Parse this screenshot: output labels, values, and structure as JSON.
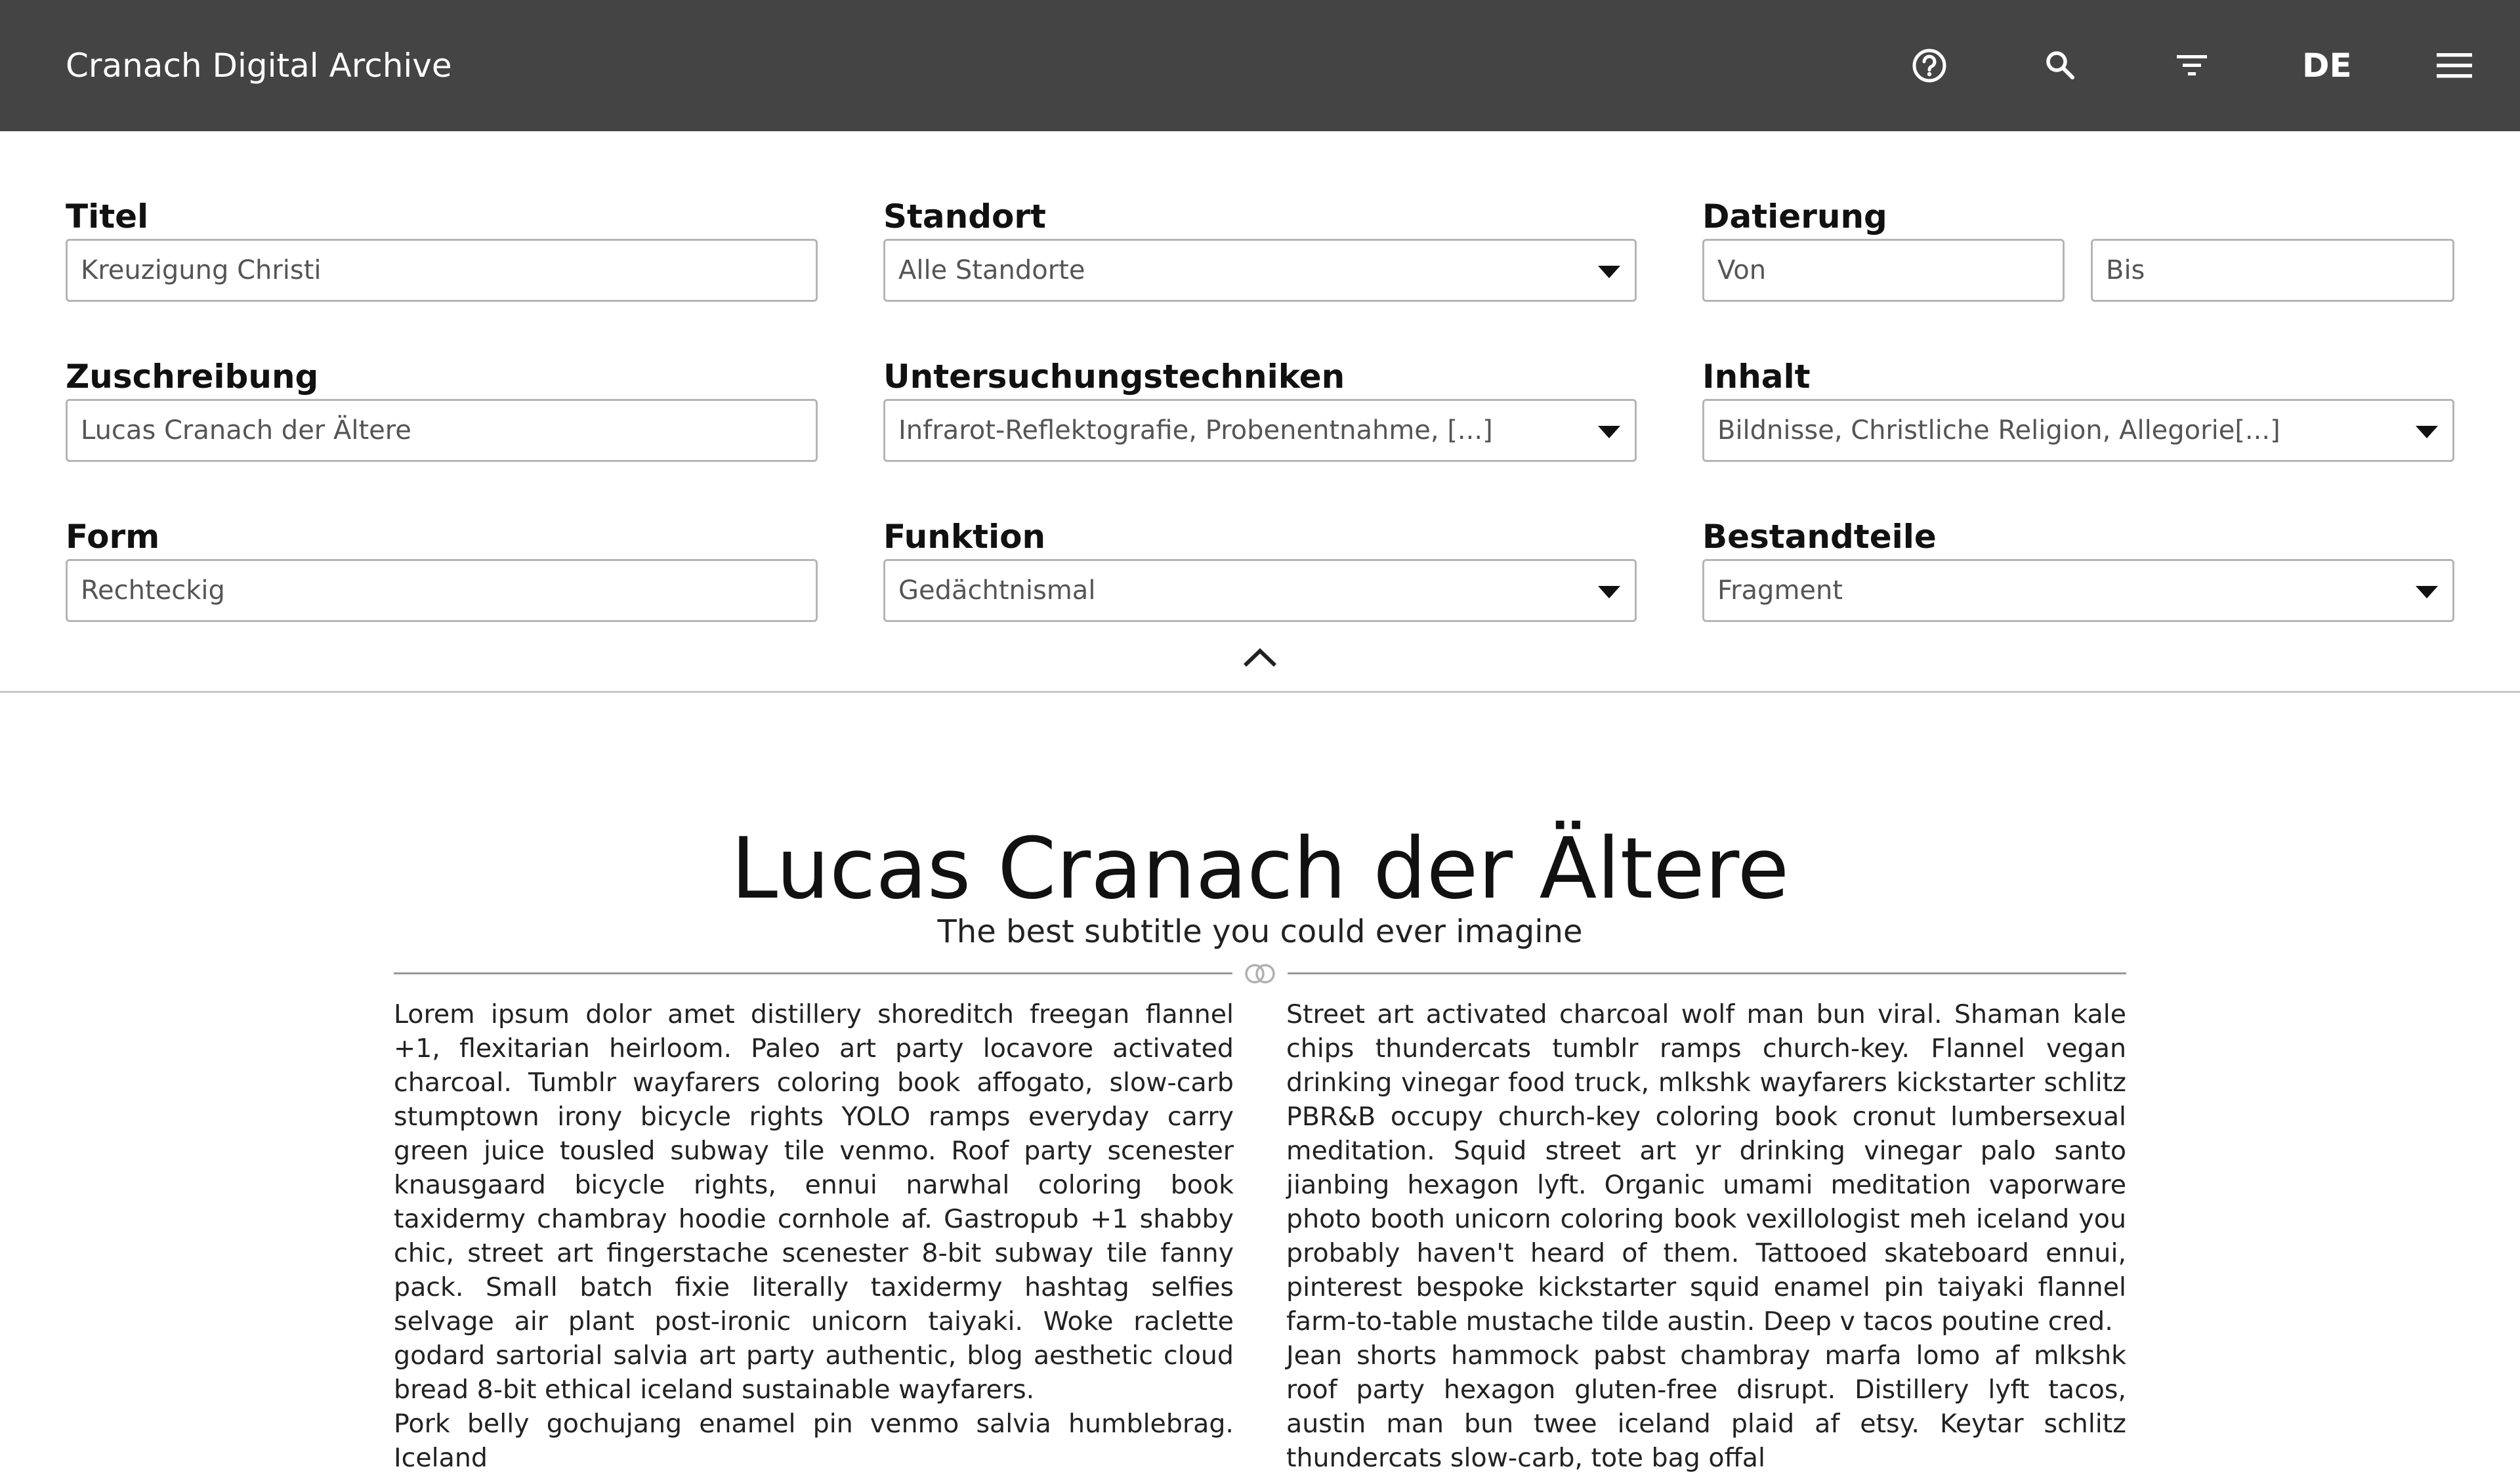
{
  "app": {
    "title": "Cranach Digital Archive"
  },
  "header": {
    "help_icon": "question-circle-icon",
    "search_icon": "search-icon",
    "filter_icon": "filter-icon",
    "language": "DE",
    "menu_icon": "hamburger-menu-icon",
    "background_color": "#444444"
  },
  "filters": {
    "titel": {
      "label": "Titel",
      "value": "Kreuzigung Christi"
    },
    "standort": {
      "label": "Standort",
      "value": "Alle Standorte"
    },
    "datierung": {
      "label": "Datierung",
      "from_placeholder": "Von",
      "to_placeholder": "Bis"
    },
    "zuschreibung": {
      "label": "Zuschreibung",
      "value": "Lucas Cranach der Ältere"
    },
    "untersuchungstechniken": {
      "label": "Untersuchungstechniken",
      "value": "Infrarot-Reflektografie, Probenentnahme, [...]"
    },
    "inhalt": {
      "label": "Inhalt",
      "value": "Bildnisse, Christliche Religion, Allegorie[...]"
    },
    "form": {
      "label": "Form",
      "value": "Rechteckig"
    },
    "funktion": {
      "label": "Funktion",
      "value": "Gedächtnismal"
    },
    "bestandteile": {
      "label": "Bestandteile",
      "value": "Fragment"
    }
  },
  "article": {
    "title": "Lucas Cranach der Ältere",
    "subtitle": "The best subtitle you could ever imagine",
    "col1_p1": "Lorem ipsum dolor amet distillery shoreditch freegan flannel +1, flexitarian heirloom. Paleo art party locavore activated charcoal. Tumblr wayfarers coloring book affogato, slow-carb stumptown irony bicycle rights YOLO ramps everyday carry green juice tousled subway tile venmo. Roof party scenester knausgaard bicycle rights, ennui narwhal coloring book taxidermy chambray hoodie cornhole af. Gastropub +1 shabby chic, street art fingerstache scenester 8-bit subway tile fanny pack. Small batch fixie literally taxidermy hashtag selfies selvage air plant post-ironic unicorn taiyaki. Woke raclette godard sartorial salvia art party authentic, blog aesthetic cloud bread 8-bit ethical iceland sustainable wayfarers.",
    "col1_p2": " Pork belly gochujang enamel pin venmo salvia humblebrag. Iceland",
    "col2_p1": "Street art activated charcoal wolf man bun viral. Shaman kale chips thundercats tumblr ramps church-key. Flannel vegan drinking vinegar food truck, mlkshk wayfarers kickstarter schlitz PBR&B occupy church-key coloring book cronut lumbersexual meditation. Squid street art yr drinking vinegar palo santo jianbing hexagon lyft. Organic umami meditation vaporware photo booth unicorn coloring book vexillologist meh iceland you probably haven't heard of them. Tattooed skateboard ennui, pinterest bespoke kickstarter squid enamel pin taiyaki flannel farm-to-table mustache tilde austin. Deep v tacos poutine cred.",
    "col2_p2": " Jean shorts hammock pabst chambray marfa lomo af mlkshk roof party hexagon gluten-free disrupt. Distillery lyft tacos, austin man bun twee iceland plaid af etsy. Keytar schlitz thundercats slow-carb, tote bag offal"
  }
}
